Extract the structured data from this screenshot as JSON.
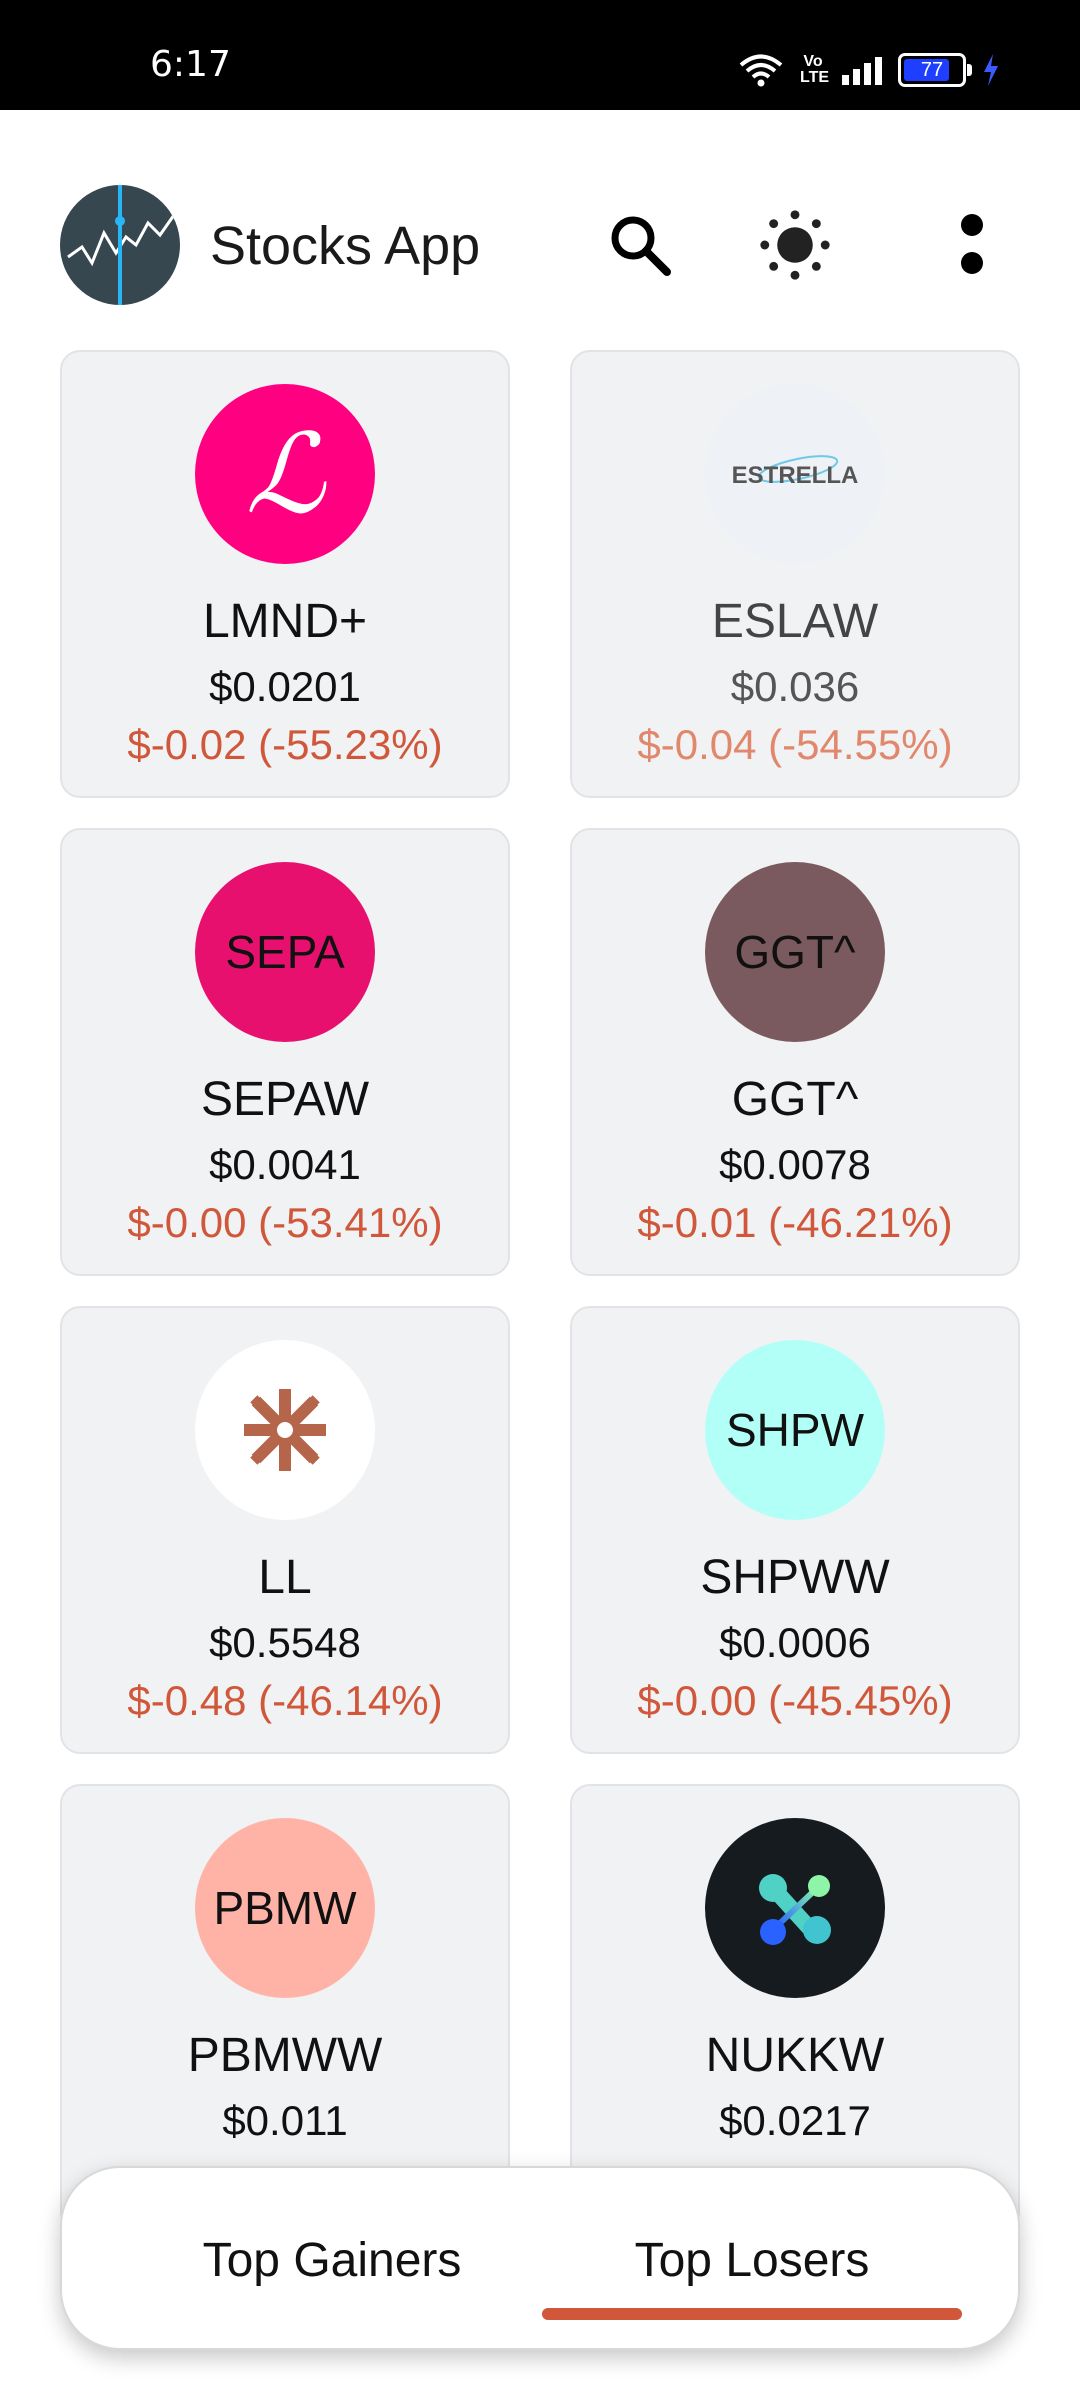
{
  "status_bar": {
    "time": "6:17",
    "battery": "77",
    "volte": "Vo\nLTE"
  },
  "app_bar": {
    "title": "Stocks App",
    "accent": "#1e88e5"
  },
  "colors": {
    "loss": "#d0573a",
    "loss_light": "#e0876c",
    "indicator": "#d0573a"
  },
  "stocks": [
    {
      "symbol": "LMND+",
      "price": "$0.0201",
      "change": "$-0.02 (-55.23%)",
      "logo_text": "ℒ",
      "logo_bg": "#ff0080",
      "logo_fg": "#ffffff",
      "logo_icon": "lemonade-logo"
    },
    {
      "symbol": "ESLAW",
      "price": "$0.036",
      "change": "$-0.04 (-54.55%)",
      "logo_text": "ESTRELLA",
      "logo_bg": "#eef1f5",
      "logo_fg": "#555555",
      "logo_icon": "estrella-logo",
      "muted": true
    },
    {
      "symbol": "SEPAW",
      "price": "$0.0041",
      "change": "$-0.00 (-53.41%)",
      "logo_text": "SEPA",
      "logo_bg": "#e8106e",
      "logo_fg": "#111111"
    },
    {
      "symbol": "GGT^",
      "price": "$0.0078",
      "change": "$-0.01 (-46.21%)",
      "logo_text": "GGT^",
      "logo_bg": "#7a5a5e",
      "logo_fg": "#111111"
    },
    {
      "symbol": "LL",
      "price": "$0.5548",
      "change": "$-0.48 (-46.14%)",
      "logo_text": "",
      "logo_bg": "#ffffff",
      "logo_fg": "#b5654a",
      "logo_icon": "lumber-liquidators-logo"
    },
    {
      "symbol": "SHPWW",
      "price": "$0.0006",
      "change": "$-0.00 (-45.45%)",
      "logo_text": "SHPW",
      "logo_bg": "#b2fff7",
      "logo_fg": "#111111"
    },
    {
      "symbol": "PBMWW",
      "price": "$0.011",
      "change": "",
      "logo_text": "PBMW",
      "logo_bg": "#ffb3a7",
      "logo_fg": "#111111"
    },
    {
      "symbol": "NUKKW",
      "price": "$0.0217",
      "change": "",
      "logo_text": "",
      "logo_bg": "#161b1f",
      "logo_fg": "#4fd1c5",
      "logo_icon": "nukkleus-logo"
    }
  ],
  "tabs": [
    {
      "label": "Top Gainers",
      "selected": false
    },
    {
      "label": "Top Losers",
      "selected": true
    }
  ]
}
